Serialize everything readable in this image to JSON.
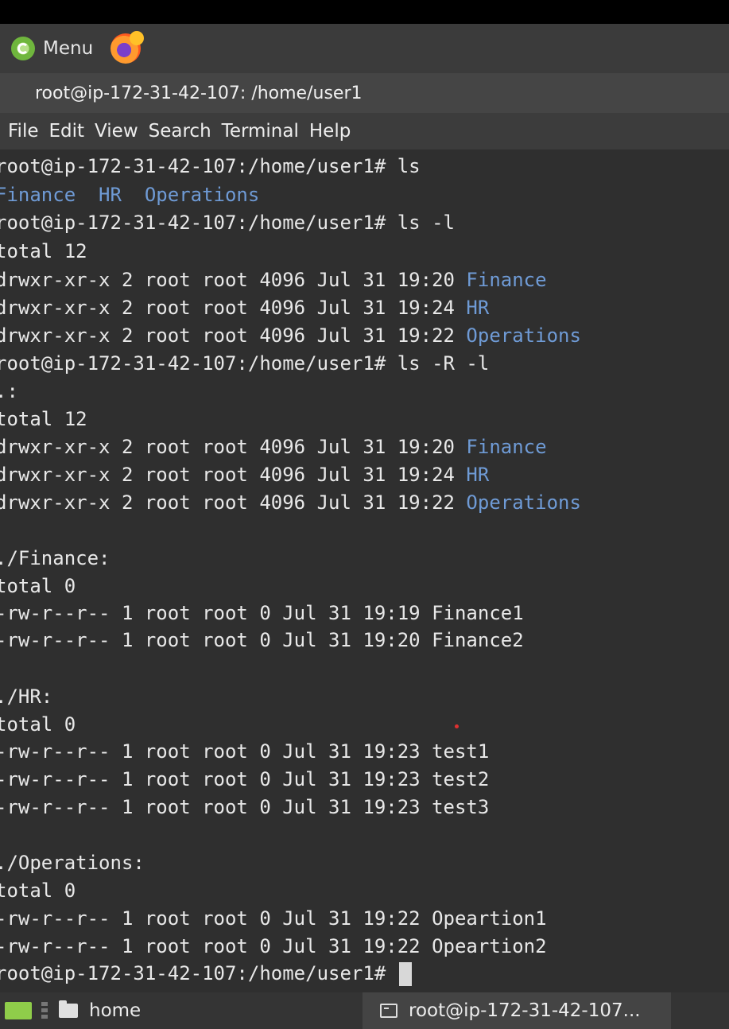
{
  "panel": {
    "menu_label": "Menu",
    "logo_icon": "linux-mint-logo-icon",
    "browser_icon": "firefox-icon"
  },
  "window": {
    "title": "root@ip-172-31-42-107: /home/user1"
  },
  "menubar": {
    "items": [
      "File",
      "Edit",
      "View",
      "Search",
      "Terminal",
      "Help"
    ]
  },
  "terminal": {
    "lines": [
      {
        "text": "root@ip-172-31-42-107:/home/user1# ls",
        "blue": ""
      },
      {
        "text": "",
        "blue": "Finance  HR  Operations"
      },
      {
        "text": "root@ip-172-31-42-107:/home/user1# ls -l",
        "blue": ""
      },
      {
        "text": "total 12",
        "blue": ""
      },
      {
        "text": "drwxr-xr-x 2 root root 4096 Jul 31 19:20 ",
        "blue": "Finance"
      },
      {
        "text": "drwxr-xr-x 2 root root 4096 Jul 31 19:24 ",
        "blue": "HR"
      },
      {
        "text": "drwxr-xr-x 2 root root 4096 Jul 31 19:22 ",
        "blue": "Operations"
      },
      {
        "text": "root@ip-172-31-42-107:/home/user1# ls -R -l",
        "blue": ""
      },
      {
        "text": ".:",
        "blue": ""
      },
      {
        "text": "total 12",
        "blue": ""
      },
      {
        "text": "drwxr-xr-x 2 root root 4096 Jul 31 19:20 ",
        "blue": "Finance"
      },
      {
        "text": "drwxr-xr-x 2 root root 4096 Jul 31 19:24 ",
        "blue": "HR"
      },
      {
        "text": "drwxr-xr-x 2 root root 4096 Jul 31 19:22 ",
        "blue": "Operations"
      },
      {
        "text": "",
        "blue": ""
      },
      {
        "text": "./Finance:",
        "blue": ""
      },
      {
        "text": "total 0",
        "blue": ""
      },
      {
        "text": "-rw-r--r-- 1 root root 0 Jul 31 19:19 Finance1",
        "blue": ""
      },
      {
        "text": "-rw-r--r-- 1 root root 0 Jul 31 19:20 Finance2",
        "blue": ""
      },
      {
        "text": "",
        "blue": ""
      },
      {
        "text": "./HR:",
        "blue": ""
      },
      {
        "text": "total 0",
        "blue": ""
      },
      {
        "text": "-rw-r--r-- 1 root root 0 Jul 31 19:23 test1",
        "blue": ""
      },
      {
        "text": "-rw-r--r-- 1 root root 0 Jul 31 19:23 test2",
        "blue": ""
      },
      {
        "text": "-rw-r--r-- 1 root root 0 Jul 31 19:23 test3",
        "blue": ""
      },
      {
        "text": "",
        "blue": ""
      },
      {
        "text": "./Operations:",
        "blue": ""
      },
      {
        "text": "total 0",
        "blue": ""
      },
      {
        "text": "-rw-r--r-- 1 root root 0 Jul 31 19:22 Opeartion1",
        "blue": ""
      },
      {
        "text": "-rw-r--r-- 1 root root 0 Jul 31 19:22 Opeartion2",
        "blue": ""
      },
      {
        "text": "root@ip-172-31-42-107:/home/user1# ",
        "blue": ""
      }
    ]
  },
  "taskbar": {
    "home_label": "home",
    "task_label": "root@ip-172-31-42-107..."
  },
  "colors": {
    "terminal_bg": "#2f2f2f",
    "dir_blue": "#6f9bd6",
    "workspace_green": "#8fcd4a"
  }
}
